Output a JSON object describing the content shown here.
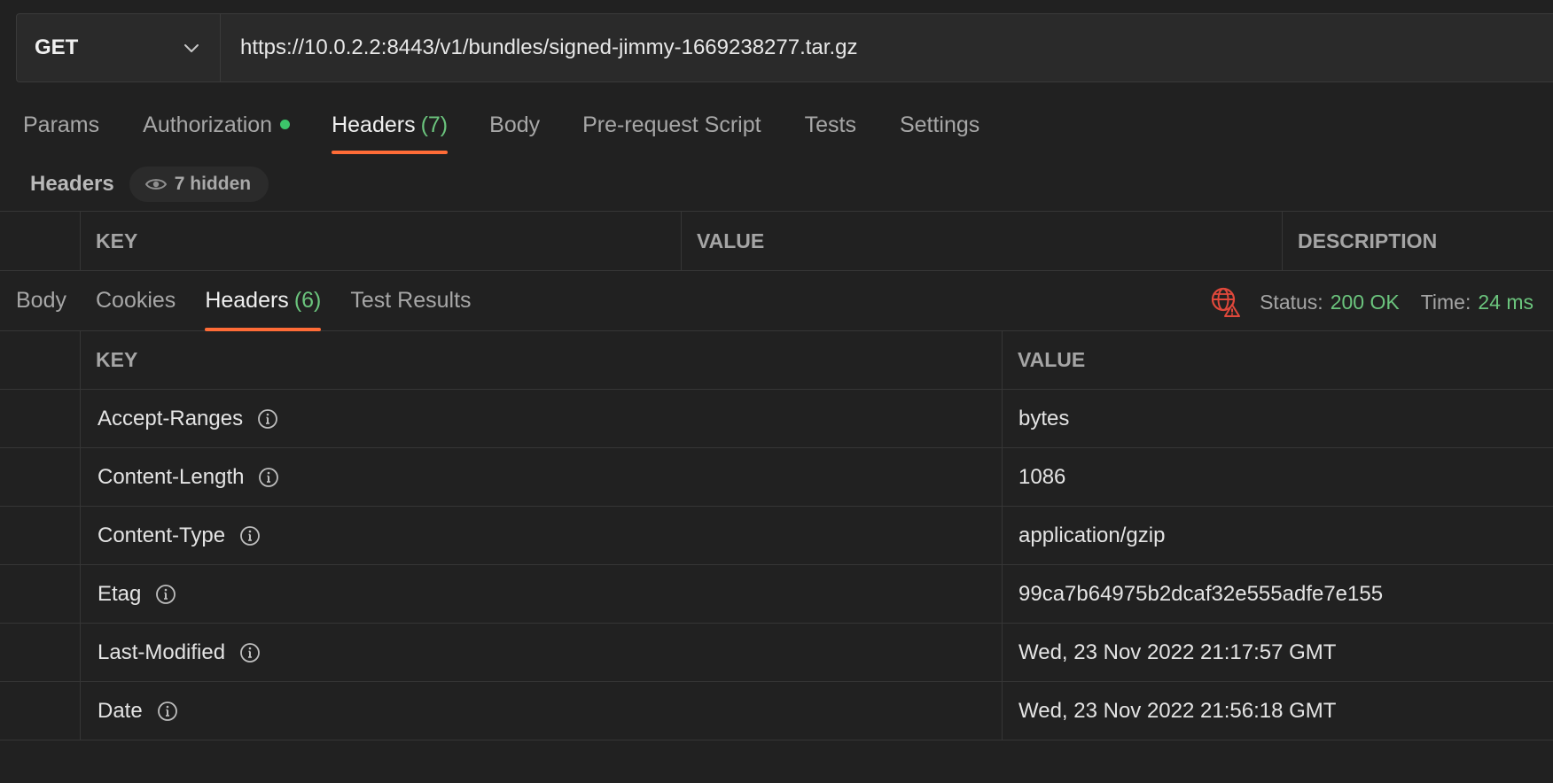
{
  "request": {
    "method": "GET",
    "url": "https://10.0.2.2:8443/v1/bundles/signed-jimmy-1669238277.tar.gz"
  },
  "request_tabs": {
    "params": "Params",
    "authorization": "Authorization",
    "headers": "Headers",
    "headers_count": "(7)",
    "body": "Body",
    "prerequest": "Pre-request Script",
    "tests": "Tests",
    "settings": "Settings"
  },
  "headers_section": {
    "title": "Headers",
    "hidden": "7 hidden"
  },
  "request_table": {
    "key": "KEY",
    "value": "VALUE",
    "description": "DESCRIPTION"
  },
  "response_tabs": {
    "body": "Body",
    "cookies": "Cookies",
    "headers": "Headers",
    "headers_count": "(6)",
    "test_results": "Test Results"
  },
  "status": {
    "status_label": "Status:",
    "status_value": "200 OK",
    "time_label": "Time:",
    "time_value": "24 ms"
  },
  "response_table": {
    "key": "KEY",
    "value": "VALUE",
    "rows": [
      {
        "key": "Accept-Ranges",
        "value": "bytes"
      },
      {
        "key": "Content-Length",
        "value": "1086"
      },
      {
        "key": "Content-Type",
        "value": "application/gzip"
      },
      {
        "key": "Etag",
        "value": "99ca7b64975b2dcaf32e555adfe7e155"
      },
      {
        "key": "Last-Modified",
        "value": "Wed, 23 Nov 2022 21:17:57 GMT"
      },
      {
        "key": "Date",
        "value": "Wed, 23 Nov 2022 21:56:18 GMT"
      }
    ]
  },
  "colors": {
    "accent": "#ff6c37",
    "success": "#6bc47d",
    "auth_dot": "#3cc46a",
    "warning_icon": "#e0483b"
  }
}
